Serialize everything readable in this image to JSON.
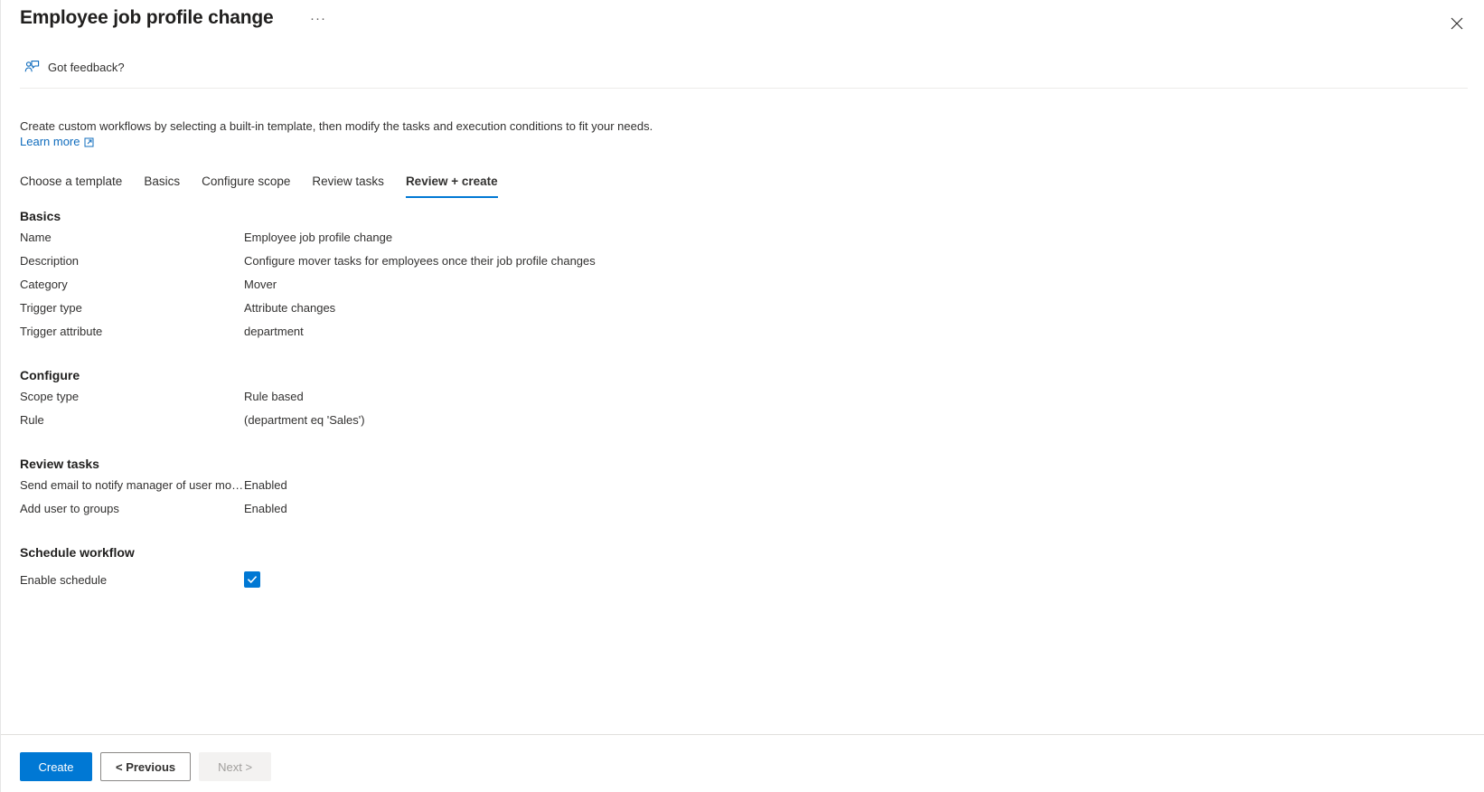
{
  "blade": {
    "title": "Employee job profile change",
    "more_menu": "···",
    "close_label": "Close",
    "feedback_label": "Got feedback?"
  },
  "intro": {
    "text": "Create custom workflows by selecting a built-in template, then modify the tasks and execution conditions to fit your needs.",
    "learn_more": "Learn more"
  },
  "tabs": [
    {
      "label": "Choose a template",
      "active": false
    },
    {
      "label": "Basics",
      "active": false
    },
    {
      "label": "Configure scope",
      "active": false
    },
    {
      "label": "Review tasks",
      "active": false
    },
    {
      "label": "Review + create",
      "active": true
    }
  ],
  "sections": [
    {
      "title": "Basics",
      "rows": [
        {
          "key": "Name",
          "value": "Employee job profile change"
        },
        {
          "key": "Description",
          "value": "Configure mover tasks for employees once their job profile changes"
        },
        {
          "key": "Category",
          "value": "Mover"
        },
        {
          "key": "Trigger type",
          "value": "Attribute changes"
        },
        {
          "key": "Trigger attribute",
          "value": "department"
        }
      ]
    },
    {
      "title": "Configure",
      "rows": [
        {
          "key": "Scope type",
          "value": "Rule based"
        },
        {
          "key": "Rule",
          "value": "(department eq 'Sales')"
        }
      ]
    },
    {
      "title": "Review tasks",
      "rows": [
        {
          "key": "Send email to notify manager of user mo…",
          "value": "Enabled"
        },
        {
          "key": "Add user to groups",
          "value": "Enabled"
        }
      ]
    }
  ],
  "schedule": {
    "title": "Schedule workflow",
    "enable_label": "Enable schedule",
    "enabled": true
  },
  "footer": {
    "create": "Create",
    "previous": "< Previous",
    "next": "Next >"
  },
  "colors": {
    "accent": "#0078d4",
    "link": "#0f6cbd",
    "text": "#323130",
    "divider": "#edebe9",
    "disabled_text": "#a19f9d",
    "disabled_bg": "#f3f2f1"
  }
}
